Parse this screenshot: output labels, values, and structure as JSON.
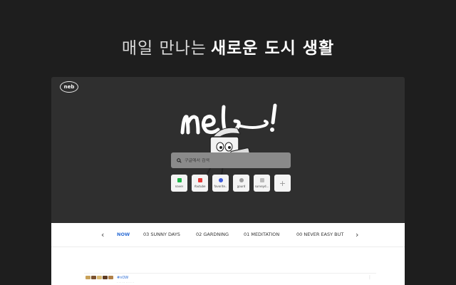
{
  "headline": {
    "regular": "매일 만나는",
    "bold": "새로운 도시 생활"
  },
  "browser": {
    "logo_badge": "neb",
    "search": {
      "placeholder": "구글에서 검색"
    },
    "shortcuts": [
      {
        "label": "naver",
        "color": "#1fb54a"
      },
      {
        "label": "Youtube",
        "color": "#e53935"
      },
      {
        "label": "favorite..",
        "color": "#3b5bdb"
      },
      {
        "label": "gourd",
        "color": "#9e9e9e"
      },
      {
        "label": "surveyd...",
        "color": "#bdbdbd"
      }
    ],
    "add_label": "+"
  },
  "tabs": {
    "prev": "‹",
    "next": "›",
    "items": [
      {
        "label": "NOW"
      },
      {
        "label": "03  SUNNY DAYS"
      },
      {
        "label": "02  GARDNING"
      },
      {
        "label": "01  MEDITATION"
      },
      {
        "label": "00  NEVER EASY BUT"
      }
    ]
  },
  "post": {
    "tag": "#nOW",
    "text": "· · · · · · · · · ·",
    "more": "⋮"
  },
  "colors": {
    "accent": "#2f6fd6",
    "background": "#1e1e1e",
    "hero": "#2f2f2f"
  }
}
